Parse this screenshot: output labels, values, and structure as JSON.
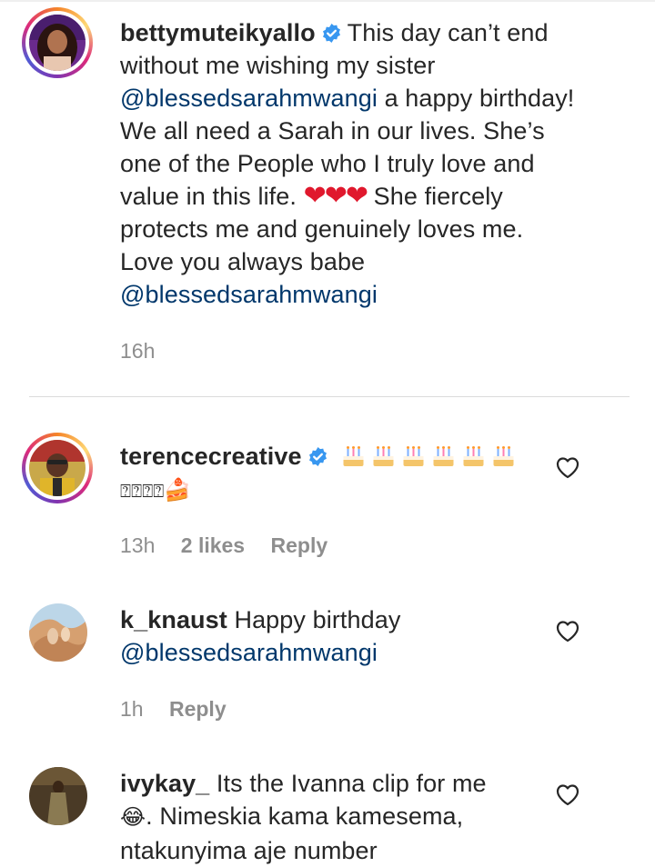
{
  "comments": [
    {
      "username": "bettymuteikyallo",
      "verified": true,
      "text_1": "This day can’t end without me wishing my sister",
      "mention_1": "@blessedsarahmwangi",
      "text_2": "a happy birthday! We all need a Sarah in our lives. She’s one of the People who I truly love and value in this life.",
      "hearts": "❤❤❤",
      "text_3": "She fiercely protects me and genuinely loves me. Love you always babe",
      "mention_2": "@blessedsarahmwangi",
      "time": "16h"
    },
    {
      "username": "terencecreative",
      "verified": true,
      "text_2": "🍰",
      "placeholder_glyphs": "⍰⍰⍰⍰",
      "time": "13h",
      "likes": "2 likes",
      "reply": "Reply"
    },
    {
      "username": "k_knaust",
      "text_1": "Happy birthday",
      "mention_1": "@blessedsarahmwangi",
      "time": "1h",
      "reply": "Reply"
    },
    {
      "username": "ivykay_",
      "text_1": "Its the Ivanna clip for me",
      "emoji": "😂",
      "text_2": ". Nimeskia kama kamesema, ntakunyima aje number"
    }
  ],
  "colors": {
    "mention": "#00376b",
    "meta": "#8e8e8e",
    "verified": "#3897f0",
    "heart": "#e0182d"
  },
  "icons": [
    "verified-badge-icon",
    "birthday-cake-icon",
    "heart-outline-icon"
  ]
}
